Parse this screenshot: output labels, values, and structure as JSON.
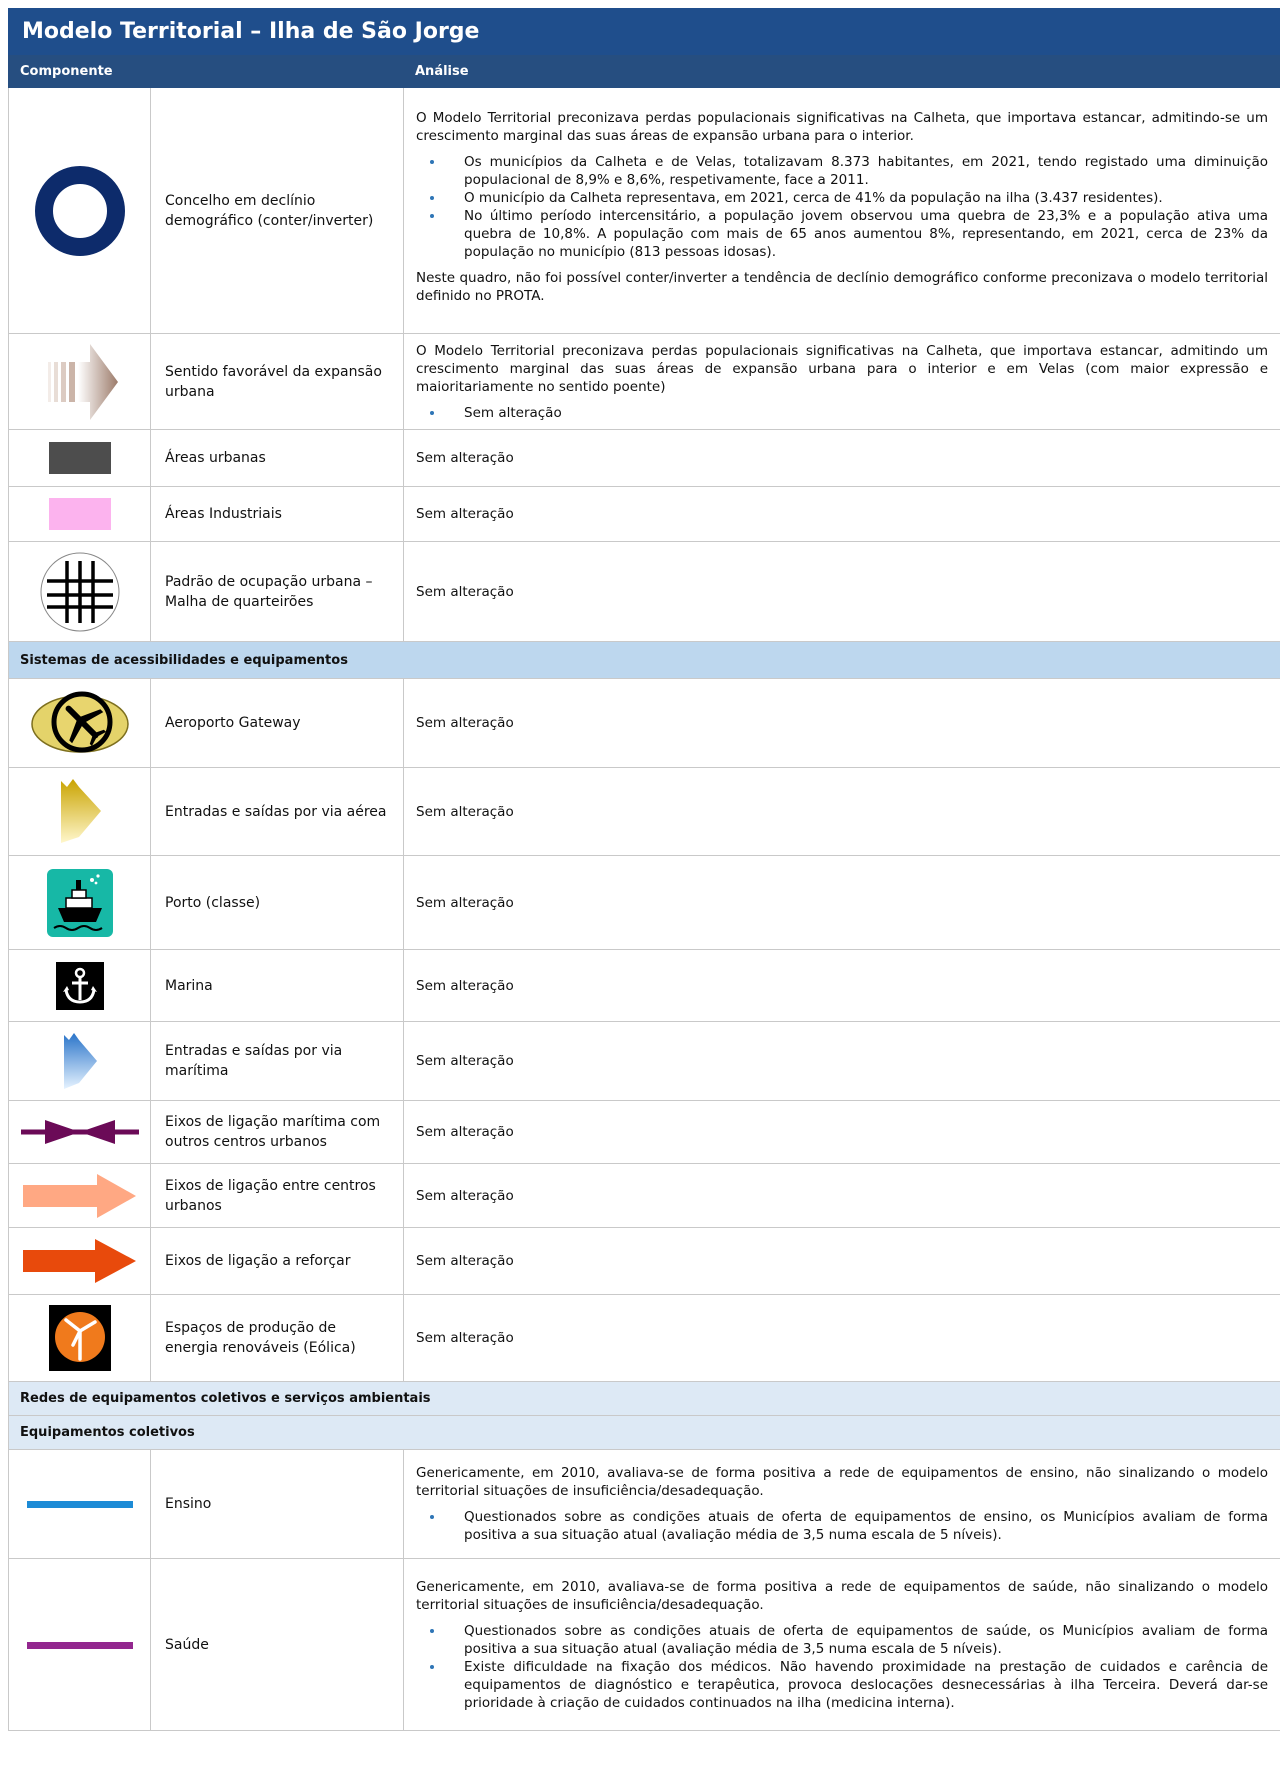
{
  "title": "Modelo Territorial – Ilha de São Jorge",
  "headers": {
    "component": "Componente",
    "analysis": "Análise"
  },
  "rows_top": [
    {
      "icon": "ring-icon",
      "label": "Concelho em declínio demográfico (conter/inverter)",
      "analysis_intro": "O Modelo Territorial preconizava perdas populacionais significativas na Calheta, que importava estancar, admitindo-se um crescimento marginal das suas áreas de expansão urbana para o interior.",
      "bullets": [
        "Os municípios da Calheta e de Velas, totalizavam 8.373 habitantes, em 2021, tendo registado uma diminuição populacional de 8,9% e 8,6%, respetivamente, face a 2011.",
        "O município da Calheta representava, em 2021, cerca de 41% da população na ilha (3.437 residentes).",
        "No último período intercensitário, a população jovem observou uma quebra de 23,3% e a população ativa uma quebra de 10,8%. A população com mais de 65 anos aumentou 8%, representando, em 2021, cerca de 23% da população no município (813 pessoas idosas)."
      ],
      "analysis_outro": "Neste quadro, não foi possível conter/inverter a tendência de declínio demográfico conforme preconizava o modelo territorial definido no PROTA."
    },
    {
      "icon": "expansion-arrow-icon",
      "label": "Sentido favorável da expansão urbana",
      "analysis_intro": "O Modelo Territorial preconizava perdas populacionais significativas na Calheta, que importava estancar, admitindo um crescimento marginal das suas áreas de expansão urbana para o interior e em Velas (com maior expressão e maioritariamente no sentido poente)",
      "bullets": [
        "Sem alteração"
      ]
    },
    {
      "icon": "urban-area-swatch-icon",
      "label": "Áreas urbanas",
      "analysis": "Sem alteração"
    },
    {
      "icon": "industrial-area-swatch-icon",
      "label": "Áreas Industriais",
      "analysis": "Sem alteração"
    },
    {
      "icon": "grid-pattern-icon",
      "label": "Padrão de ocupação urbana – Malha de quarteirões",
      "analysis": "Sem alteração"
    }
  ],
  "section_access": "Sistemas de acessibilidades e equipamentos",
  "rows_access": [
    {
      "icon": "airport-icon",
      "label": "Aeroporto Gateway",
      "analysis": "Sem alteração"
    },
    {
      "icon": "air-entry-icon",
      "label": "Entradas e saídas por via aérea",
      "analysis": "Sem alteração"
    },
    {
      "icon": "ship-icon",
      "label": "Porto (classe)",
      "analysis": "Sem alteração"
    },
    {
      "icon": "anchor-icon",
      "label": "Marina",
      "analysis": "Sem alteração"
    },
    {
      "icon": "sea-entry-icon",
      "label": "Entradas e saídas por via marítima",
      "analysis": "Sem alteração"
    },
    {
      "icon": "maritime-link-icon",
      "label": "Eixos de ligação marítima com outros centros urbanos",
      "analysis": "Sem alteração"
    },
    {
      "icon": "light-orange-arrow-icon",
      "label": "Eixos de ligação entre centros urbanos",
      "analysis": "Sem alteração"
    },
    {
      "icon": "dark-orange-arrow-icon",
      "label": "Eixos de ligação a reforçar",
      "analysis": "Sem alteração"
    },
    {
      "icon": "wind-energy-icon",
      "label": "Espaços de produção de energia renováveis (Eólica)",
      "analysis": "Sem alteração"
    }
  ],
  "section_networks": "Redes de equipamentos coletivos e serviços ambientais",
  "subsection_collective": "Equipamentos coletivos",
  "rows_collective": [
    {
      "icon": "blue-line-icon",
      "label": "Ensino",
      "analysis_intro": "Genericamente, em 2010, avaliava-se de forma positiva a rede de equipamentos de ensino, não sinalizando o modelo territorial situações de insuficiência/desadequação.",
      "bullets": [
        "Questionados sobre as condições atuais de oferta de equipamentos de ensino, os Municípios avaliam de forma positiva a sua situação atual (avaliação média de 3,5 numa escala de 5 níveis)."
      ]
    },
    {
      "icon": "purple-line-icon",
      "label": "Saúde",
      "analysis_intro": "Genericamente, em 2010, avaliava-se de forma positiva a rede de equipamentos de saúde, não sinalizando o modelo territorial situações de insuficiência/desadequação.",
      "bullets": [
        "Questionados sobre as condições atuais de oferta de equipamentos de saúde, os Municípios avaliam de forma positiva a sua situação atual (avaliação média de 3,5 numa escala de 5 níveis).",
        "Existe dificuldade na fixação dos médicos. Não havendo proximidade na prestação de cuidados e carência de equipamentos de diagnóstico e terapêutica, provoca deslocações desnecessárias à ilha Terceira. Deverá dar-se prioridade à criação de cuidados continuados na ilha (medicina interna)."
      ]
    }
  ],
  "colors": {
    "title_bg": "#1f4e8c",
    "header_bg": "#264e80",
    "section_bg": "#bdd7ee",
    "subsection_bg": "#dde9f5",
    "bullet": "#2e75b6"
  }
}
